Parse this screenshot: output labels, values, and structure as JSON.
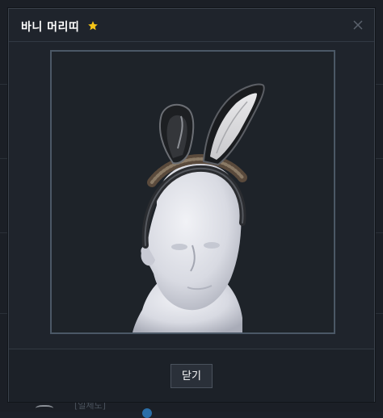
{
  "modal": {
    "title": "바니 머리띠",
    "title_icon": "star-icon",
    "close_icon": "close-icon",
    "image_alt": "bunny-headband-on-mannequin"
  },
  "footer": {
    "close_label": "닫기"
  },
  "background": {
    "footer_text": "[일체도]"
  },
  "colors": {
    "star": "#f5c518",
    "frame_border": "#4b5866",
    "modal_bg": "#1f242c"
  }
}
